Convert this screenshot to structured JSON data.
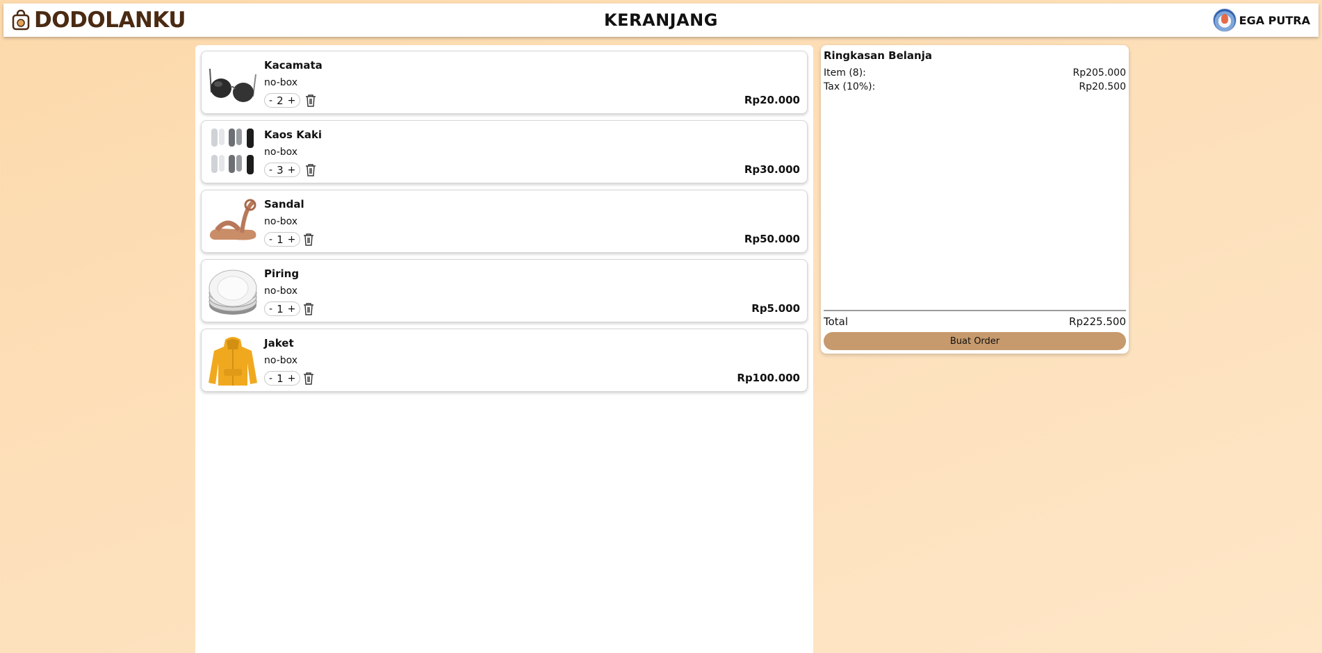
{
  "header": {
    "brand": "DODOLANKU",
    "page_title": "KERANJANG",
    "user_name": "EGA PUTRA"
  },
  "cart": {
    "items": [
      {
        "name": "Kacamata",
        "variant": "no-box",
        "qty": "2",
        "price": "Rp20.000",
        "icon": "sunglasses-image"
      },
      {
        "name": "Kaos Kaki",
        "variant": "no-box",
        "qty": "3",
        "price": "Rp30.000",
        "icon": "socks-image"
      },
      {
        "name": "Sandal",
        "variant": "no-box",
        "qty": "1",
        "price": "Rp50.000",
        "icon": "sandal-image"
      },
      {
        "name": "Piring",
        "variant": "no-box",
        "qty": "1",
        "price": "Rp5.000",
        "icon": "plates-image"
      },
      {
        "name": "Jaket",
        "variant": "no-box",
        "qty": "1",
        "price": "Rp100.000",
        "icon": "jacket-image"
      }
    ],
    "minus_label": "-",
    "plus_label": "+"
  },
  "summary": {
    "title": "Ringkasan Belanja",
    "items_label": "Item (8):",
    "items_value": "Rp205.000",
    "tax_label": "Tax (10%):",
    "tax_value": "Rp20.500",
    "total_label": "Total",
    "total_value": "Rp225.500",
    "order_button": "Buat Order"
  },
  "colors": {
    "brand": "#4a2a12",
    "button": "#c69a6d",
    "background": "#fcd9ab"
  }
}
